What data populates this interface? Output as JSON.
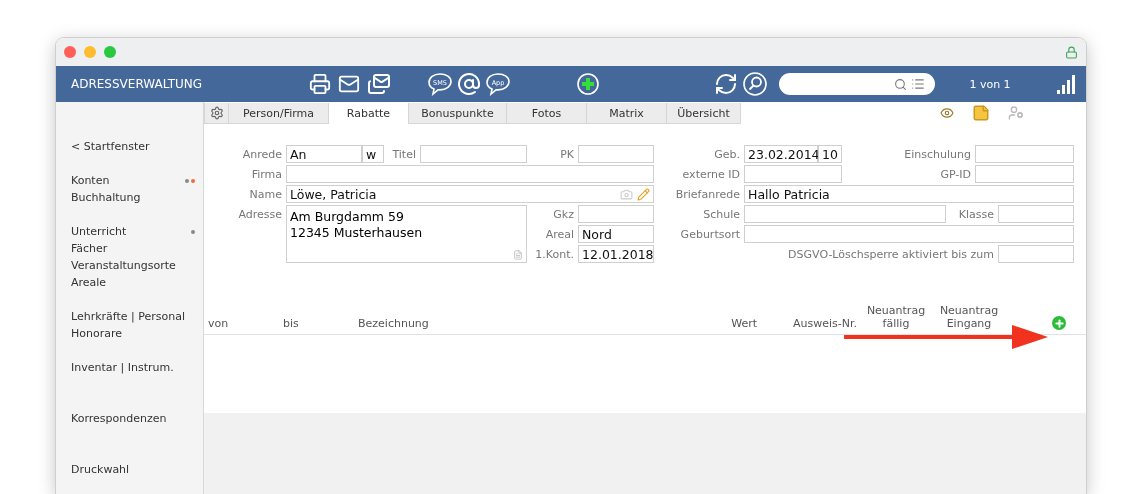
{
  "header": {
    "title": "ADRESSVERWALTUNG",
    "bubbles": [
      {
        "text": "SMS"
      },
      {
        "text": "App"
      }
    ],
    "record_count": "1 von 1"
  },
  "sidebar": {
    "groups": [
      {
        "items": [
          {
            "label": "< Startfenster"
          }
        ]
      },
      {
        "items": [
          {
            "label": "Konten",
            "markers": [
              {
                "color": "#888888"
              },
              {
                "color": "#f26b3a"
              }
            ]
          },
          {
            "label": "Buchhaltung"
          }
        ]
      },
      {
        "items": [
          {
            "label": "Unterricht",
            "markers": [
              {
                "color": "#888888"
              }
            ]
          },
          {
            "label": "Fächer"
          },
          {
            "label": "Veranstaltungsorte"
          },
          {
            "label": "Areale"
          }
        ]
      },
      {
        "items": [
          {
            "label": "Lehrkräfte | Personal"
          },
          {
            "label": "Honorare"
          }
        ]
      },
      {
        "items": [
          {
            "label": "Inventar | Instrum."
          }
        ]
      },
      {
        "items": [
          {
            "label": "Korrespondenzen"
          }
        ]
      },
      {
        "items": [
          {
            "label": "Druckwahl"
          }
        ]
      }
    ]
  },
  "tabs": [
    {
      "label": "Person/Firma",
      "selected": false
    },
    {
      "label": "Rabatte",
      "selected": true
    },
    {
      "label": "Bonuspunkte",
      "selected": false
    },
    {
      "label": "Fotos",
      "selected": false
    },
    {
      "label": "Matrix",
      "selected": false
    },
    {
      "label": "Übersicht",
      "selected": false
    }
  ],
  "form": {
    "anrede": {
      "label": "Anrede",
      "value": "An"
    },
    "geschlecht": {
      "value": "w"
    },
    "titel": {
      "label": "Titel"
    },
    "pk": {
      "label": "PK"
    },
    "firma": {
      "label": "Firma"
    },
    "name": {
      "label": "Name",
      "value": "Löwe, Patricia"
    },
    "adresse": {
      "label": "Adresse",
      "lines": [
        "Am Burgdamm 59",
        "12345 Musterhausen"
      ]
    },
    "gkz": {
      "label": "Gkz"
    },
    "areal": {
      "label": "Areal",
      "value": "Nord"
    },
    "kontakt": {
      "label": "1.Kont.",
      "value": "12.01.2018"
    },
    "geb": {
      "label": "Geb.",
      "value": "23.02.2014",
      "age": "10"
    },
    "einschulung": {
      "label": "Einschulung"
    },
    "externe_id": {
      "label": "externe ID"
    },
    "gp_id": {
      "label": "GP-ID"
    },
    "briefanrede": {
      "label": "Briefanrede",
      "value": "Hallo Patricia"
    },
    "schule": {
      "label": "Schule"
    },
    "klasse": {
      "label": "Klasse"
    },
    "geburtsort": {
      "label": "Geburtsort"
    },
    "dsgvo": {
      "label": "DSGVO-Löschsperre aktiviert bis zum"
    }
  },
  "table": {
    "columns": [
      "von",
      "bis",
      "Bezeichnung",
      "Wert",
      "Ausweis-Nr.",
      "Neuantrag\nfällig",
      "Neuantrag\nEingang"
    ]
  }
}
